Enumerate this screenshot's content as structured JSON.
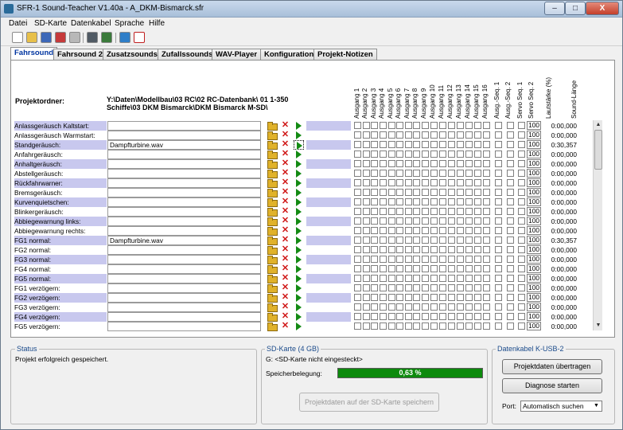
{
  "window": {
    "title": "SFR-1 Sound-Teacher V1.40a - A_DKM-Bismarck.sfr",
    "minimize": "–",
    "maximize": "□",
    "close": "X"
  },
  "menu": [
    "Datei",
    "SD-Karte",
    "Datenkabel",
    "Sprache",
    "Hilfe"
  ],
  "toolbar": {
    "icons": [
      "new-icon",
      "open-icon",
      "save-icon",
      "save-as-icon",
      "print-icon",
      "calculator-icon",
      "transfer-icon",
      "music-note-icon",
      "pdf-icon"
    ]
  },
  "tabs": [
    "Fahrsound",
    "Fahrsound 2",
    "Zusatzsounds",
    "Zufallssounds",
    "WAV-Player",
    "Konfiguration",
    "Projekt-Notizen"
  ],
  "active_tab": "Fahrsound",
  "project": {
    "label": "Projektordner:",
    "path_line1": "Y:\\Daten\\Modellbau\\03 RC\\02 RC-Datenbank\\ 01 1-350",
    "path_line2": "Schiffe\\03 DKM Bismarck\\DKM Bismarck M-SD\\"
  },
  "column_headers": [
    "Ausgang 1",
    "Ausgang 2",
    "Ausgang 3",
    "Ausgang 4",
    "Ausgang 5",
    "Ausgang 6",
    "Ausgang 7",
    "Ausgang 8",
    "Ausgang 9",
    "Ausgang 10",
    "Ausgang 11",
    "Ausgang 12",
    "Ausgang 13",
    "Ausgang 14",
    "Ausgang 15",
    "Ausgang 16",
    "Ausg.-Seq. 1",
    "Ausg.-Seq. 2",
    "Servo Seq. 1",
    "Servo Seq. 2",
    "Lautstärke (%)",
    "Sound-Länge"
  ],
  "rows": [
    {
      "label": "Anlassgeräusch Kaltstart:",
      "file": "",
      "volume": "100",
      "length": "0:00,000"
    },
    {
      "label": "Anlassgeräusch Warmstart:",
      "file": "",
      "volume": "100",
      "length": "0:00,000"
    },
    {
      "label": "Standgeräusch:",
      "file": "Dampfturbine.wav",
      "volume": "100",
      "length": "0:30,357"
    },
    {
      "label": "Anfahrgeräusch:",
      "file": "",
      "volume": "100",
      "length": "0:00,000"
    },
    {
      "label": "Anhaltgeräusch:",
      "file": "",
      "volume": "100",
      "length": "0:00,000"
    },
    {
      "label": "Abstellgeräusch:",
      "file": "",
      "volume": "100",
      "length": "0:00,000"
    },
    {
      "label": "Rückfahrwarner:",
      "file": "",
      "volume": "100",
      "length": "0:00,000"
    },
    {
      "label": "Bremsgeräusch:",
      "file": "",
      "volume": "100",
      "length": "0:00,000"
    },
    {
      "label": "Kurvenquietschen:",
      "file": "",
      "volume": "100",
      "length": "0:00,000"
    },
    {
      "label": "Blinkergeräusch:",
      "file": "",
      "volume": "100",
      "length": "0:00,000"
    },
    {
      "label": "Abbiegewarnung links:",
      "file": "",
      "volume": "100",
      "length": "0:00,000"
    },
    {
      "label": "Abbiegewarnung rechts:",
      "file": "",
      "volume": "100",
      "length": "0:00,000"
    },
    {
      "label": "FG1 normal:",
      "file": "Dampfturbine.wav",
      "volume": "100",
      "length": "0:30,357"
    },
    {
      "label": "FG2 normal:",
      "file": "",
      "volume": "100",
      "length": "0:00,000"
    },
    {
      "label": "FG3 normal:",
      "file": "",
      "volume": "100",
      "length": "0:00,000"
    },
    {
      "label": "FG4 normal:",
      "file": "",
      "volume": "100",
      "length": "0:00,000"
    },
    {
      "label": "FG5 normal:",
      "file": "",
      "volume": "100",
      "length": "0:00,000"
    },
    {
      "label": "FG1 verzögern:",
      "file": "",
      "volume": "100",
      "length": "0:00,000"
    },
    {
      "label": "FG2 verzögern:",
      "file": "",
      "volume": "100",
      "length": "0:00,000"
    },
    {
      "label": "FG3 verzögern:",
      "file": "",
      "volume": "100",
      "length": "0:00,000"
    },
    {
      "label": "FG4 verzögern:",
      "file": "",
      "volume": "100",
      "length": "0:00,000"
    },
    {
      "label": "FG5 verzögern:",
      "file": "",
      "volume": "100",
      "length": "0:00,000"
    }
  ],
  "status": {
    "title": "Status",
    "text": "Projekt erfolgreich gespeichert."
  },
  "sdcard": {
    "title": "SD-Karte (4 GB)",
    "drive": "G: <SD-Karte nicht eingesteckt>",
    "usage_label": "Speicherbelegung:",
    "usage_text": "0,63 %",
    "usage_fraction": 0.0063,
    "save_button": "Projektdaten auf der SD-Karte speichern"
  },
  "cable": {
    "title": "Datenkabel K-USB-2",
    "transfer_button": "Projektdaten übertragen",
    "diagnose_button": "Diagnose starten",
    "port_label": "Port:",
    "port_value": "Automatisch suchen"
  },
  "colors": {
    "row_alt": "#c8c8ee",
    "progress": "#0d8a0d",
    "active_tab_text": "#0035a0",
    "delete": "#d01818",
    "play": "#138a13"
  }
}
